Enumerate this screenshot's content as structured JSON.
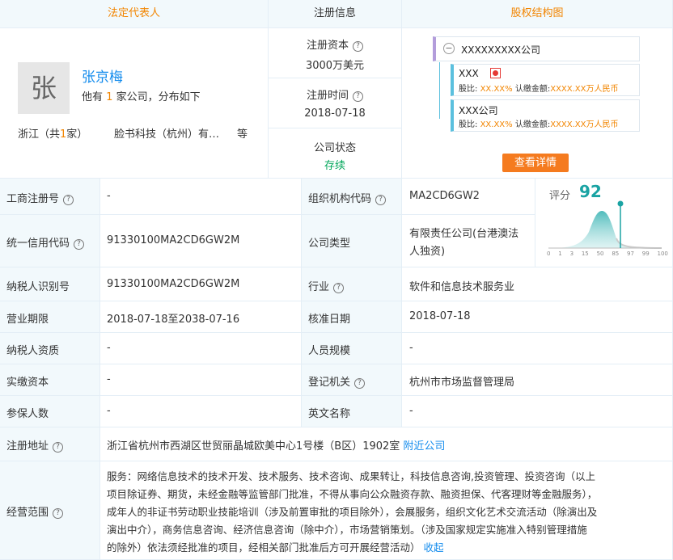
{
  "header": {
    "legal_rep": "法定代表人",
    "reg_info": "注册信息",
    "equity_chart": "股权结构图"
  },
  "legal_rep": {
    "avatar_char": "张",
    "name": "张京梅",
    "desc_prefix": "他有",
    "desc_count": "1",
    "desc_suffix": "家公司，分布如下",
    "province_prefix": "浙江（共",
    "province_count": "1",
    "province_suffix": "家）",
    "company": "脸书科技（杭州）有…",
    "more": "等"
  },
  "reg": {
    "capital_label": "注册资本",
    "capital_value": "3000万美元",
    "time_label": "注册时间",
    "time_value": "2018-07-18",
    "status_label": "公司状态",
    "status_value": "存续"
  },
  "equity": {
    "root_company": "XXXXXXXXX公司",
    "node1_name": "XXX",
    "node1_ratio_label": "股比:",
    "node1_ratio": "XX.XX%",
    "node1_sub_label": "认缴金额:",
    "node1_sub": "XXXX.XX万人民币",
    "node2_name": "XXX公司",
    "node2_ratio_label": "股比:",
    "node2_ratio": "XX.XX%",
    "node2_sub_label": "认缴金额:",
    "node2_sub": "XXXX.XX万人民币",
    "detail_button": "查看详情"
  },
  "score": {
    "label": "评分",
    "value": "92",
    "ticks": [
      "0",
      "1",
      "3",
      "15",
      "50",
      "85",
      "97",
      "99",
      "100"
    ]
  },
  "rows": {
    "biz_reg_no_label": "工商注册号",
    "biz_reg_no": "-",
    "org_code_label": "组织机构代码",
    "org_code": "MA2CD6GW2",
    "credit_code_label": "统一信用代码",
    "credit_code": "91330100MA2CD6GW2M",
    "company_type_label": "公司类型",
    "company_type_line1": "有限责任公司(台港澳法",
    "company_type_line2": "人独资)",
    "taxpayer_id_label": "纳税人识别号",
    "taxpayer_id": "91330100MA2CD6GW2M",
    "industry_label": "行业",
    "industry": "软件和信息技术服务业",
    "term_label": "营业期限",
    "term": "2018-07-18至2038-07-16",
    "approval_date_label": "核准日期",
    "approval_date": "2018-07-18",
    "tax_qual_label": "纳税人资质",
    "tax_qual": "-",
    "staff_label": "人员规模",
    "staff": "-",
    "paid_capital_label": "实缴资本",
    "paid_capital": "-",
    "authority_label": "登记机关",
    "authority": "杭州市市场监督管理局",
    "insured_label": "参保人数",
    "insured": "-",
    "english_name_label": "英文名称",
    "english_name": "-",
    "address_label": "注册地址",
    "address": "浙江省杭州市西湖区世贸丽晶城欧美中心1号楼（B区）1902室",
    "nearby_link": "附近公司",
    "scope_label": "经营范围",
    "scope_line1": "服务：网络信息技术的技术开发、技术服务、技术咨询、成果转让，科技信息咨询,投资管理、投资咨询（以上",
    "scope_line2": "项目除证券、期货，未经金融等监管部门批准，不得从事向公众融资存款、融资担保、代客理财等金融服务），",
    "scope_line3": "成年人的非证书劳动职业技能培训（涉及前置审批的项目除外），会展服务，组织文化艺术交流活动（除演出及",
    "scope_line4": "演出中介），商务信息咨询、经济信息咨询（除中介），市场营销策划。（涉及国家规定实施准入特别管理措施",
    "scope_line5": "的除外）依法须经批准的项目，经相关部门批准后方可开展经营活动）",
    "collapse_link": "收起"
  },
  "colors": {
    "orange": "#f28500",
    "link": "#128bed",
    "green": "#00a65a",
    "label_bg": "#f2f9fc"
  }
}
